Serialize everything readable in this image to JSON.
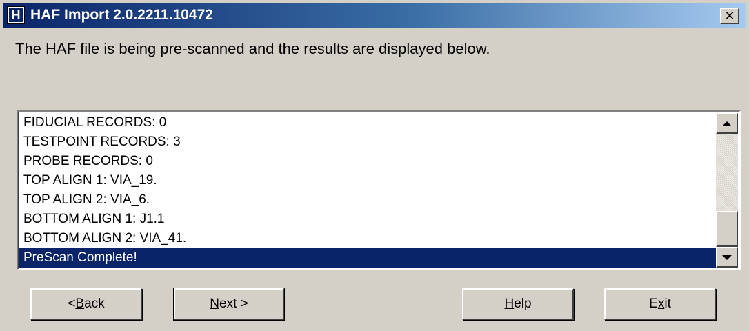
{
  "window": {
    "title": "HAF Import 2.0.2211.10472",
    "icon_letter": "H",
    "close_glyph": "✕"
  },
  "description": "The HAF file is being pre-scanned and the results are displayed below.",
  "results": {
    "items": [
      "FIDUCIAL RECORDS: 0",
      "TESTPOINT RECORDS: 3",
      "PROBE RECORDS: 0",
      "TOP ALIGN 1: VIA_19.",
      "TOP ALIGN 2: VIA_6.",
      "BOTTOM ALIGN 1: J1.1",
      "BOTTOM ALIGN 2: VIA_41.",
      "PreScan Complete!"
    ],
    "selected_index": 7
  },
  "buttons": {
    "back": {
      "pre": "< ",
      "accel": "B",
      "post": "ack"
    },
    "next": {
      "pre": "",
      "accel": "N",
      "post": "ext >"
    },
    "help": {
      "pre": "",
      "accel": "H",
      "post": "elp"
    },
    "exit": {
      "pre": "E",
      "accel": "x",
      "post": "it"
    }
  },
  "colors": {
    "selection": "#0a246a",
    "face": "#d4d0c8"
  }
}
